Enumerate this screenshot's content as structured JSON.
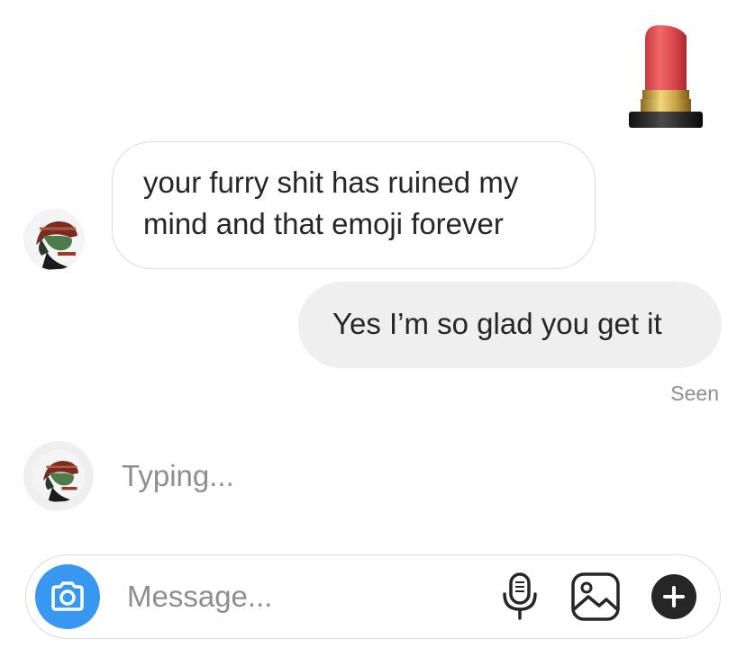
{
  "conversation": {
    "sticker": "lipstick-emoji",
    "messages": [
      {
        "direction": "incoming",
        "text": "your furry shit has ruined my mind and that emoji forever",
        "line1": "your furry shit has ruined my",
        "line2": "mind and that emoji forever"
      },
      {
        "direction": "outgoing",
        "text": "Yes I’m so glad you get it"
      }
    ],
    "seen_label": "Seen",
    "typing_label": "Typing..."
  },
  "composer": {
    "placeholder": "Message...",
    "camera_icon": "camera-icon",
    "mic_icon": "microphone-icon",
    "gallery_icon": "image-gallery-icon",
    "more_icon": "plus-icon"
  },
  "colors": {
    "accent": "#3897f0",
    "outgoing_bubble": "#efefef",
    "incoming_border": "#dbdbdb",
    "secondary_text": "#8e8e8e"
  }
}
